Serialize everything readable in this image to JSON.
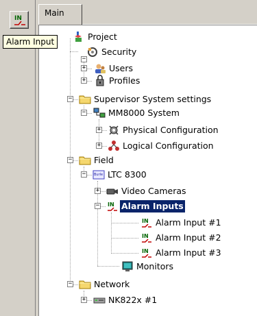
{
  "toolbar": {
    "alarm_button_text": "IN",
    "tooltip": "Alarm Input"
  },
  "tabs": {
    "main": "Main"
  },
  "tree": {
    "project": "Project",
    "security": "Security",
    "users": "Users",
    "profiles": "Profiles",
    "supervisor": "Supervisor System settings",
    "mm8000": "MM8000 System",
    "physical": "Physical Configuration",
    "logical": "Logical Configuration",
    "field": "Field",
    "ltc": "LTC 8300",
    "video": "Video Cameras",
    "alarm_inputs": "Alarm Inputs",
    "alarm1": "Alarm Input #1",
    "alarm2": "Alarm Input #2",
    "alarm3": "Alarm Input #3",
    "monitors": "Monitors",
    "network": "Network",
    "nk822": "NK822x #1"
  },
  "colors": {
    "selection": "#0a246a",
    "tooltip_bg": "#ffffe1",
    "window_bg": "#d4d0c8"
  }
}
